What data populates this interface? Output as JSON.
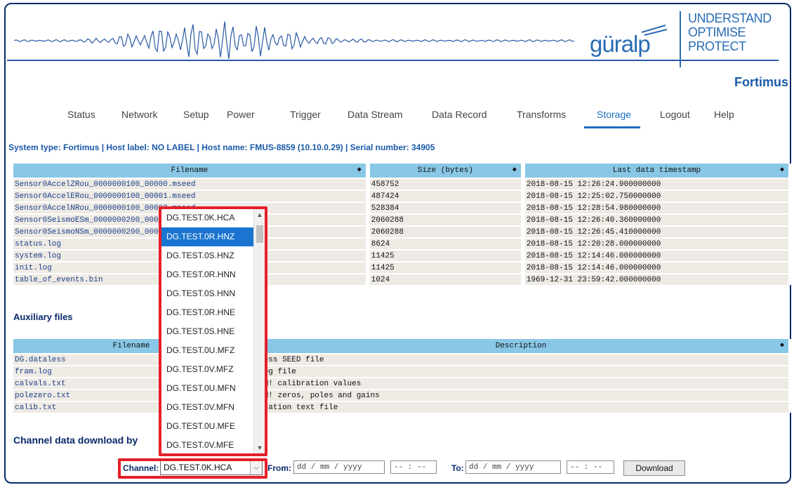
{
  "brand": {
    "logo": "güralp",
    "tagline": [
      "UNDERSTAND",
      "OPTIMISE",
      "PROTECT"
    ],
    "product": "Fortimus",
    "waveform_icon": "seismic-waveform-icon"
  },
  "nav": {
    "items": [
      "Status",
      "Network",
      "Setup",
      "Power",
      "Trigger",
      "Data Stream",
      "Data Record",
      "Transforms",
      "Storage",
      "Logout",
      "Help"
    ],
    "active": "Storage"
  },
  "system_info": "System type: Fortimus | Host label: NO LABEL | Host name: FMUS-8859 (10.10.0.29) | Serial number: 34905",
  "files_table": {
    "headers": [
      "Filename",
      "Size (bytes)",
      "Last data timestamp"
    ],
    "sort_icon": "sort-icon",
    "rows": [
      [
        "Sensor0AccelZRou_0000000100_00000.mseed",
        "458752",
        "2018-08-15 12:26:24.900000000"
      ],
      [
        "Sensor0AccelERou_0000000100_00001.mseed",
        "487424",
        "2018-08-15 12:25:02.750000000"
      ],
      [
        "Sensor0AccelNRou_0000000100_00002.mseed",
        "528384",
        "2018-08-15 12:28:54.980000000"
      ],
      [
        "Sensor0SeismoESm_0000000200_00000.mseed",
        "2060288",
        "2018-08-15 12:26:40.360000000"
      ],
      [
        "Sensor0SeismoNSm_0000000200_00001.mseed",
        "2060288",
        "2018-08-15 12:26:45.410000000"
      ],
      [
        "status.log",
        "8624",
        "2018-08-15 12:20:28.000000000"
      ],
      [
        "system.log",
        "11425",
        "2018-08-15 12:14:46.000000000"
      ],
      [
        "init.log",
        "11425",
        "2018-08-15 12:14:46.000000000"
      ],
      [
        "table_of_events.bin",
        "1024",
        "1969-12-31 23:59:42.000000000"
      ]
    ]
  },
  "aux_title": "Auxiliary files",
  "aux_table": {
    "headers": [
      "Filename",
      "Description"
    ],
    "rows": [
      [
        "DG.dataless",
        "less SEED file"
      ],
      [
        "fram.log",
        " log file"
      ],
      [
        "calvals.txt",
        "AM! calibration values"
      ],
      [
        "polezero.txt",
        "AM! zeros, poles and gains"
      ],
      [
        "calib.txt",
        "bration text file"
      ]
    ]
  },
  "download": {
    "title": "Channel data download by",
    "channel_label": "Channel:",
    "channel_value": "DG.TEST.0K.HCA",
    "from_label": "From:",
    "from_date": "dd / mm / yyyy",
    "from_time": "-- : --",
    "to_label": "To:",
    "to_date": "dd / mm / yyyy",
    "to_time": "-- : --",
    "button": "Download"
  },
  "channel_options": [
    "DG.TEST.0K.HCA",
    "DG.TEST.0R.HNZ",
    "DG.TEST.0S.HNZ",
    "DG.TEST.0R.HNN",
    "DG.TEST.0S.HNN",
    "DG.TEST.0R.HNE",
    "DG.TEST.0S.HNE",
    "DG.TEST.0U.MFZ",
    "DG.TEST.0V.MFZ",
    "DG.TEST.0U.MFN",
    "DG.TEST.0V.MFN",
    "DG.TEST.0U.MFE",
    "DG.TEST.0V.MFE"
  ],
  "channel_highlighted": "DG.TEST.0R.HNZ",
  "colors": {
    "accent": "#1a6cc0",
    "header_bg": "#89c7e6",
    "row_bg": "#eeeae4",
    "highlight": "#e4202a",
    "selected_option": "#1b75d0"
  }
}
